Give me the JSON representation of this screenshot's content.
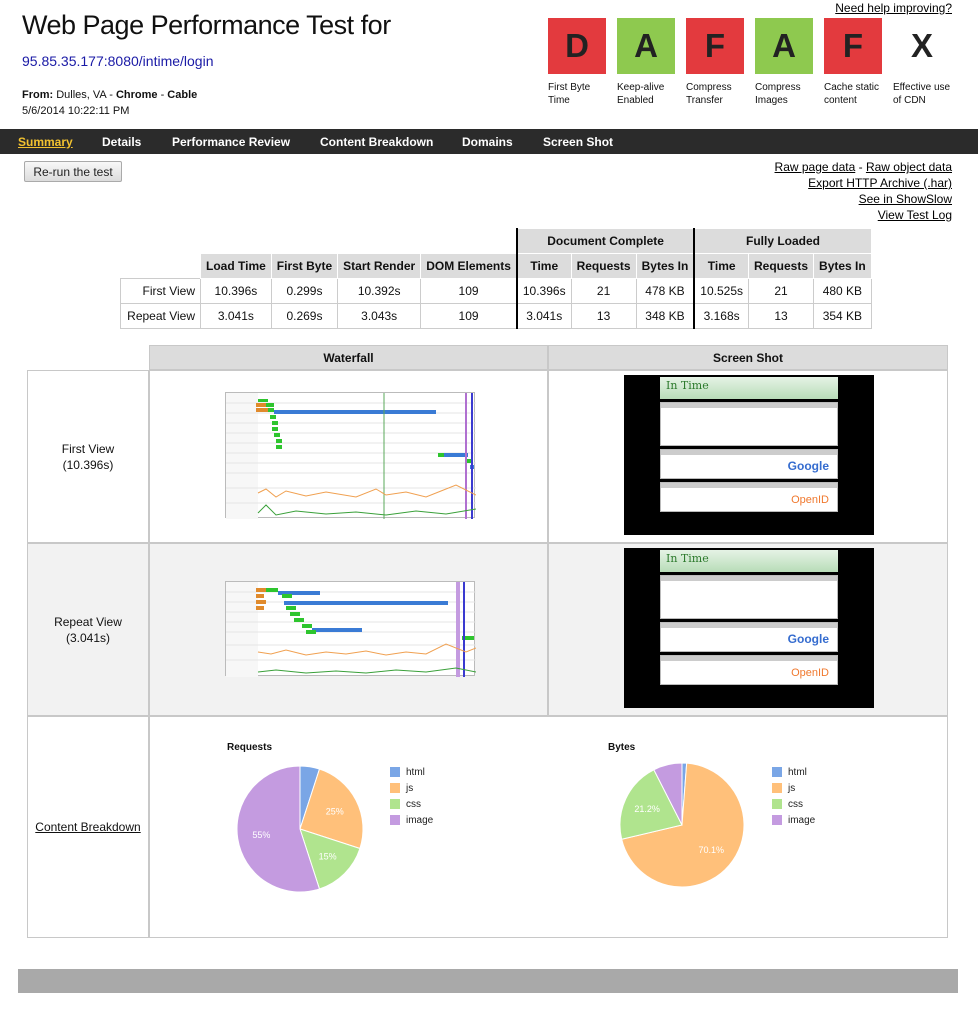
{
  "header": {
    "title": "Web Page Performance Test for",
    "url": "95.85.35.177:8080/intime/login",
    "from_label": "From:",
    "from_location": "Dulles, VA",
    "from_sep1": " - ",
    "browser": "Chrome",
    "from_sep2": " - ",
    "connection": "Cable",
    "date": "5/6/2014 10:22:11 PM",
    "help_link": "Need help improving?"
  },
  "grades": [
    {
      "letter": "D",
      "label": "First Byte Time",
      "color": "#e33a3e"
    },
    {
      "letter": "A",
      "label": "Keep-alive Enabled",
      "color": "#8ec94f"
    },
    {
      "letter": "F",
      "label": "Compress Transfer",
      "color": "#e33a3e"
    },
    {
      "letter": "A",
      "label": "Compress Images",
      "color": "#8ec94f"
    },
    {
      "letter": "F",
      "label": "Cache static content",
      "color": "#e33a3e"
    },
    {
      "letter": "X",
      "label": "Effective use of CDN",
      "color": "#ffffff"
    }
  ],
  "nav": {
    "items": [
      "Summary",
      "Details",
      "Performance Review",
      "Content Breakdown",
      "Domains",
      "Screen Shot"
    ],
    "active": "Summary",
    "active_color": "#f2c230"
  },
  "actions": {
    "rerun": "Re-run the test",
    "raw_page": "Raw page data",
    "sep": " - ",
    "raw_object": "Raw object data",
    "export_har": "Export HTTP Archive (.har)",
    "showslow": "See in ShowSlow",
    "test_log": "View Test Log"
  },
  "summary_table": {
    "group_doc": "Document Complete",
    "group_full": "Fully Loaded",
    "columns": [
      "Load Time",
      "First Byte",
      "Start Render",
      "DOM Elements",
      "Time",
      "Requests",
      "Bytes In",
      "Time",
      "Requests",
      "Bytes In"
    ],
    "rows": [
      {
        "label": "First View",
        "values": [
          "10.396s",
          "0.299s",
          "10.392s",
          "109",
          "10.396s",
          "21",
          "478 KB",
          "10.525s",
          "21",
          "480 KB"
        ]
      },
      {
        "label": "Repeat View",
        "values": [
          "3.041s",
          "0.269s",
          "3.043s",
          "109",
          "3.041s",
          "13",
          "348 KB",
          "3.168s",
          "13",
          "354 KB"
        ]
      }
    ]
  },
  "results": {
    "waterfall_header": "Waterfall",
    "screenshot_header": "Screen Shot",
    "first_view": {
      "label": "First View",
      "time": "(10.396s)"
    },
    "repeat_view": {
      "label": "Repeat View",
      "time": "(3.041s)"
    },
    "content_breakdown_link": "Content Breakdown",
    "screenshot_title": "In Time",
    "screenshot_brand_google": "Google",
    "screenshot_brand_openid": "OpenID"
  },
  "chart_data": [
    {
      "type": "pie",
      "title": "Requests",
      "categories": [
        "html",
        "js",
        "css",
        "image"
      ],
      "values": [
        5,
        25,
        15,
        55
      ],
      "value_labels": [
        "",
        "25%",
        "15%",
        "55%"
      ],
      "colors": [
        "#7aa6e6",
        "#ffc07a",
        "#b0e48e",
        "#c49be0"
      ]
    },
    {
      "type": "pie",
      "title": "Bytes",
      "categories": [
        "html",
        "js",
        "css",
        "image"
      ],
      "values": [
        1.2,
        70.1,
        21.2,
        7.5
      ],
      "value_labels": [
        "",
        "70.1%",
        "21.2%",
        ""
      ],
      "colors": [
        "#7aa6e6",
        "#ffc07a",
        "#b0e48e",
        "#c49be0"
      ]
    }
  ]
}
